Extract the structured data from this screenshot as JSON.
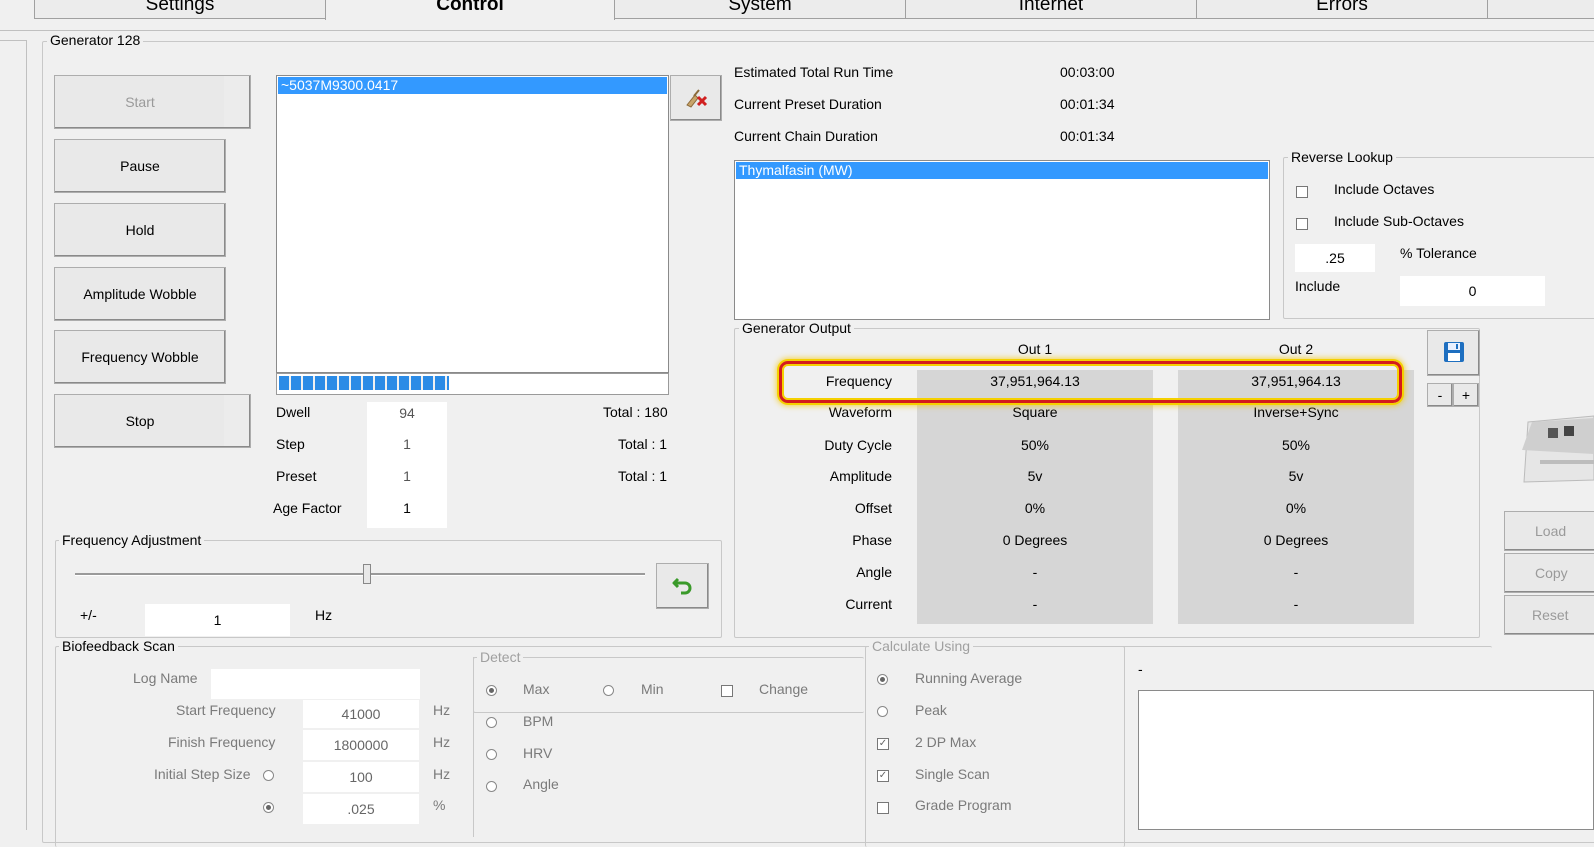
{
  "tabs": [
    "Settings",
    "Control",
    "System",
    "Internet",
    "Errors"
  ],
  "generator": {
    "title": "Generator 128",
    "buttons": [
      "Start",
      "Pause",
      "Hold",
      "Amplitude Wobble",
      "Frequency Wobble",
      "Stop"
    ],
    "program_list": [
      "~5037M9300.0417"
    ],
    "progress_fraction": 0.44,
    "counters": [
      {
        "label": "Dwell",
        "value": "94",
        "total": "Total : 180"
      },
      {
        "label": "Step",
        "value": "1",
        "total": "Total : 1"
      },
      {
        "label": "Preset",
        "value": "1",
        "total": "Total : 1"
      },
      {
        "label": "Age Factor",
        "value": "1",
        "total": ""
      }
    ]
  },
  "run_info": [
    {
      "label": "Estimated Total Run Time",
      "value": "00:03:00"
    },
    {
      "label": "Current Preset Duration",
      "value": "00:01:34"
    },
    {
      "label": "Current Chain Duration",
      "value": "00:01:34"
    }
  ],
  "preset_list": [
    "Thymalfasin (MW)"
  ],
  "reverse_lookup": {
    "title": "Reverse Lookup",
    "include_octaves": "Include Octaves",
    "include_sub_octaves": "Include Sub-Octaves",
    "tolerance_value": ".25",
    "tolerance_label": "% Tolerance",
    "include_label": "Include",
    "include_value": "0"
  },
  "frequency_adjustment": {
    "title": "Frequency Adjustment",
    "slider_fraction": 0.51,
    "plusminus_label": "+/-",
    "step_value": "1",
    "unit": "Hz"
  },
  "generator_output": {
    "title": "Generator Output",
    "col1": "Out 1",
    "col2": "Out 2",
    "minus": "-",
    "plus": "+",
    "rows": [
      {
        "label": "Frequency",
        "out1": "37,951,964.13",
        "out2": "37,951,964.13"
      },
      {
        "label": "Waveform",
        "out1": "Square",
        "out2": "Inverse+Sync"
      },
      {
        "label": "Duty Cycle",
        "out1": "50%",
        "out2": "50%"
      },
      {
        "label": "Amplitude",
        "out1": "5v",
        "out2": "5v"
      },
      {
        "label": "Offset",
        "out1": "0%",
        "out2": "0%"
      },
      {
        "label": "Phase",
        "out1": "0 Degrees",
        "out2": "0 Degrees"
      },
      {
        "label": "Angle",
        "out1": "-",
        "out2": "-"
      },
      {
        "label": "Current",
        "out1": "-",
        "out2": "-"
      }
    ]
  },
  "side_buttons": [
    "Load",
    "Copy",
    "Reset"
  ],
  "biofeedback": {
    "title": "Biofeedback Scan",
    "log_name_label": "Log Name",
    "log_name_value": "",
    "fields": [
      {
        "label": "Start Frequency",
        "value": "41000",
        "unit": "Hz"
      },
      {
        "label": "Finish Frequency",
        "value": "1800000",
        "unit": "Hz"
      },
      {
        "label": "Initial Step Size",
        "value": "100",
        "unit": "Hz"
      },
      {
        "label": "",
        "value": ".025",
        "unit": "%"
      }
    ],
    "detect_title": "Detect",
    "detect_options": [
      "Max",
      "Min",
      "Change"
    ],
    "detect_list": [
      "BPM",
      "HRV",
      "Angle"
    ],
    "calc_title": "Calculate Using",
    "calc_options": [
      "Running Average",
      "Peak",
      "2 DP Max",
      "Single Scan",
      "Grade Program"
    ]
  },
  "graph_label": "-",
  "colors": {
    "highlight": "#3399ff",
    "callout": "#d41b1b",
    "callout_glow": "#f5d000"
  }
}
